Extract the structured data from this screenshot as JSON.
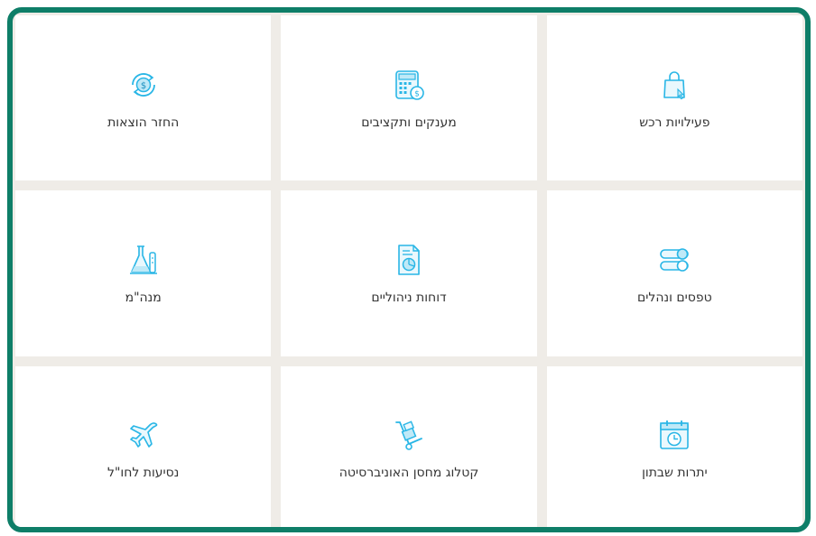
{
  "colors": {
    "frame_border": "#0e7e68",
    "grid_gap": "#efece7",
    "tile_bg": "#ffffff",
    "icon_stroke": "#29b6e6",
    "icon_fill": "#bfe9f7",
    "label_text": "#333333"
  },
  "tiles": [
    {
      "label": "פעילויות רכש",
      "icon": "shopping-bag-icon"
    },
    {
      "label": "מענקים ותקציבים",
      "icon": "calculator-dollar-icon"
    },
    {
      "label": "החזר הוצאות",
      "icon": "dollar-refresh-icon"
    },
    {
      "label": "טפסים ונהלים",
      "icon": "toggle-switches-icon"
    },
    {
      "label": "דוחות ניהוליים",
      "icon": "report-document-icon"
    },
    {
      "label": "מנה\"מ",
      "icon": "lab-flask-icon"
    },
    {
      "label": "יתרות שבתון",
      "icon": "calendar-clock-icon"
    },
    {
      "label": "קטלוג מחסן האוניברסיטה",
      "icon": "hand-truck-icon"
    },
    {
      "label": "נסיעות לחו\"ל",
      "icon": "airplane-icon"
    }
  ]
}
